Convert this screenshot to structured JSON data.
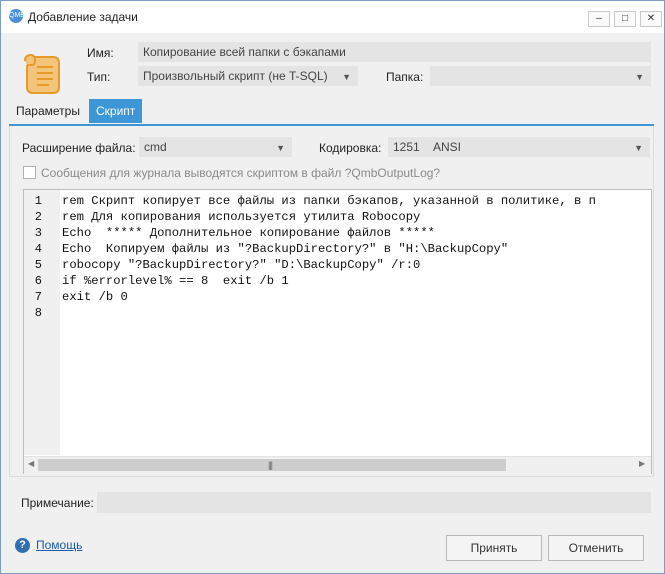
{
  "window": {
    "title": "Добавление задачи",
    "app_icon_text": "QMB",
    "minimize": "–",
    "maximize": "□",
    "close": "✕"
  },
  "form": {
    "name_label": "Имя:",
    "name_value": "Копирование всей папки с бэкапами",
    "type_label": "Тип:",
    "type_value": "Произвольный скрипт (не T-SQL)",
    "folder_label": "Папка:",
    "folder_value": ""
  },
  "tabs": [
    {
      "label": "Параметры",
      "active": false
    },
    {
      "label": "Скрипт",
      "active": true
    }
  ],
  "script": {
    "ext_label": "Расширение файла:",
    "ext_value": "cmd",
    "encoding_label": "Кодировка:",
    "encoding_code": "1251",
    "encoding_name": "ANSI",
    "log_checkbox_label": "Сообщения для журнала выводятся скриптом в файл ?QmbOutputLog?",
    "log_checkbox_checked": false,
    "line_numbers": [
      "1",
      "2",
      "3",
      "4",
      "5",
      "6",
      "7",
      "8"
    ],
    "lines": [
      "rem Скрипт копирует все файлы из папки бэкапов, указанной в политике, в п",
      "rem Для копирования используется утилита Robocopy",
      "Echo  ***** Дополнительное копирование файлов *****",
      "Echo  Копируем файлы из \"?BackupDirectory?\" в \"H:\\BackupCopy\"",
      "robocopy \"?BackupDirectory?\" \"D:\\BackupCopy\" /r:0",
      "if %errorlevel% == 8  exit /b 1",
      "exit /b 0",
      ""
    ]
  },
  "footer": {
    "note_label": "Примечание:",
    "note_value": "",
    "help_icon": "?",
    "help_label": "Помощь",
    "accept_label": "Принять",
    "cancel_label": "Отменить"
  },
  "colors": {
    "accent": "#3d97d6",
    "field_bg": "#e4e4e4",
    "link": "#1a5aa8"
  }
}
